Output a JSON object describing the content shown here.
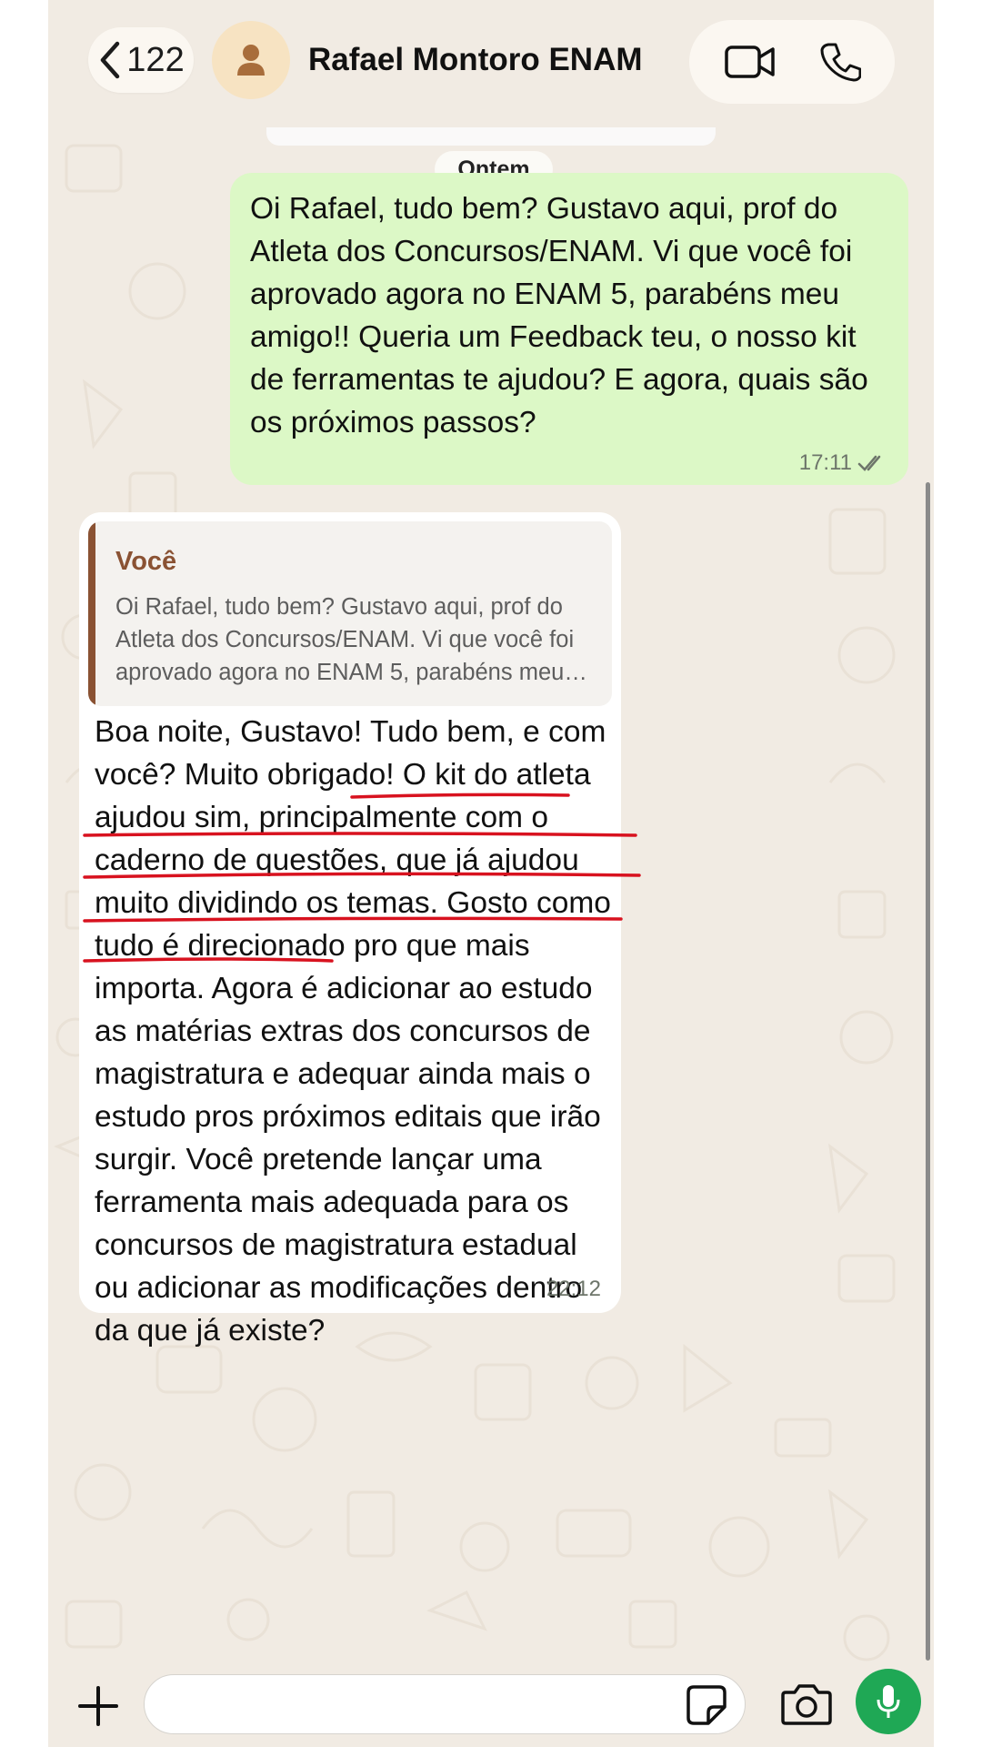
{
  "header": {
    "back_count": "122",
    "contact_name": "Rafael Montoro ENAM"
  },
  "chat": {
    "date_separator": "Ontem",
    "outgoing": {
      "text": "Oi Rafael, tudo bem? Gustavo aqui, prof do Atleta dos Concursos/ENAM. Vi que você foi aprovado agora no ENAM 5, parabéns meu amigo!! Queria um Feedback teu, o nosso kit de ferramentas te ajudou? E agora, quais são os próximos passos?",
      "time": "17:11",
      "status": "read"
    },
    "incoming": {
      "quote_author": "Você",
      "quote_text": "Oi Rafael, tudo bem? Gustavo aqui, prof do Atleta dos Concursos/ENAM. Vi que você foi aprovado agora no ENAM 5, parabéns meu amigo!! Queria um Feedback…",
      "text": "Boa noite, Gustavo! Tudo bem, e com você? Muito obrigado! O kit do atleta ajudou sim, principalmente com o caderno de questões, que já ajudou muito dividindo os temas. Gosto como tudo é direcionado pro que mais importa. Agora é adicionar ao estudo as matérias extras dos concursos de magistratura e adequar ainda mais o estudo pros próximos editais que irão surgir. Você pretende lançar uma ferramenta mais adequada para os concursos de magistratura estadual ou adicionar as modificações dentro da que já existe?",
      "time": "22:12"
    }
  },
  "composer": {
    "input_value": ""
  },
  "colors": {
    "outgoing_bubble": "#dcf8c6",
    "chat_background": "#f1ebe3",
    "quote_accent": "#8a5233",
    "annotation_red": "#d8121f",
    "mic_green": "#1fa855"
  }
}
